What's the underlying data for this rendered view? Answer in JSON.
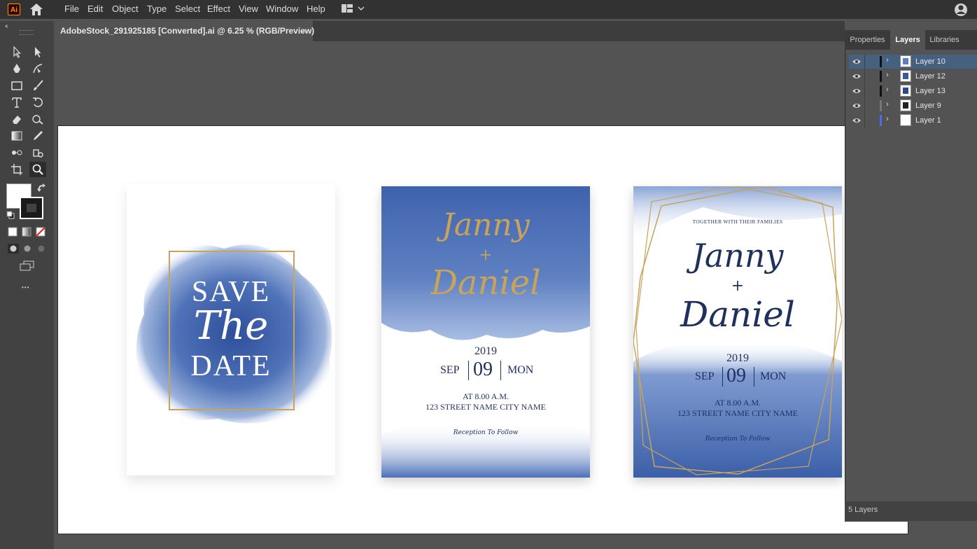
{
  "app": {
    "logo_text": "Ai"
  },
  "menu": [
    "File",
    "Edit",
    "Object",
    "Type",
    "Select",
    "Effect",
    "View",
    "Window",
    "Help"
  ],
  "document": {
    "tab_title": "AdobeStock_291925185 [Converted].ai @ 6.25 % (RGB/Preview)",
    "close_glyph": "×"
  },
  "toolbar": {
    "collapse_glyph": "‹‹",
    "more_glyph": "•••"
  },
  "panel": {
    "tabs": [
      "Properties",
      "Layers",
      "Libraries"
    ],
    "active_tab": "Layers",
    "layers": [
      {
        "name": "Layer 10",
        "color": "#111111",
        "selected": true
      },
      {
        "name": "Layer 12",
        "color": "#111111",
        "selected": false
      },
      {
        "name": "Layer 13",
        "color": "#111111",
        "selected": false
      },
      {
        "name": "Layer 9",
        "color": "#777777",
        "selected": false
      },
      {
        "name": "Layer 1",
        "color": "#4f6bed",
        "selected": false
      }
    ],
    "footer": "5 Layers"
  },
  "cards": {
    "save_the_date": {
      "line1": "SAVE",
      "line2": "The",
      "line3": "DATE"
    },
    "invite1": {
      "name1": "Janny",
      "plus": "+",
      "name2": "Daniel",
      "year": "2019",
      "month": "SEP",
      "day": "09",
      "weekday": "MON",
      "time": "AT 8.00 A.M.",
      "address": "123 STREET NAME CITY NAME",
      "reception": "Reception To Follow"
    },
    "invite2": {
      "header": "TOGETHER WITH THEIR FAMILIES",
      "name1": "Janny",
      "plus": "+",
      "name2": "Daniel",
      "year": "2019",
      "month": "SEP",
      "day": "09",
      "weekday": "MON",
      "time": "AT 8.00 A.M.",
      "address": "123 STREET NAME CITY NAME",
      "reception": "Reception To Follow"
    }
  },
  "colors": {
    "navy": "#1f2f5e",
    "gold": "#c8a35a",
    "watercolor": "#4a6fb0"
  }
}
